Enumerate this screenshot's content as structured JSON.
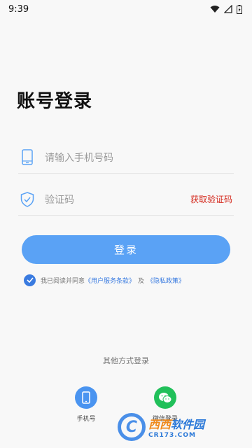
{
  "status_bar": {
    "time": "9:39"
  },
  "page": {
    "title": "账号登录"
  },
  "form": {
    "phone_placeholder": "请输入手机号码",
    "code_placeholder": "验证码",
    "get_code_label": "获取验证码",
    "login_label": "登录"
  },
  "agreement": {
    "prefix": "我已阅读并同意",
    "user_agreement": "《用户服务条款》",
    "conjunction": "及",
    "privacy_policy": "《隐私政策》"
  },
  "other_login": {
    "title": "其他方式登录",
    "options": [
      {
        "label": "手机号",
        "icon": "phone-icon",
        "color": "#4a94f0"
      },
      {
        "label": "微信登录",
        "icon": "wechat-icon",
        "color": "#21c05a"
      }
    ]
  },
  "watermark": {
    "logo_letter": "C",
    "brand_a": "西西",
    "brand_b": "软件园",
    "domain": "CR173.COM"
  },
  "colors": {
    "primary": "#5aa2f5",
    "accent_red": "#d4281c",
    "link_blue": "#3a7be0"
  }
}
